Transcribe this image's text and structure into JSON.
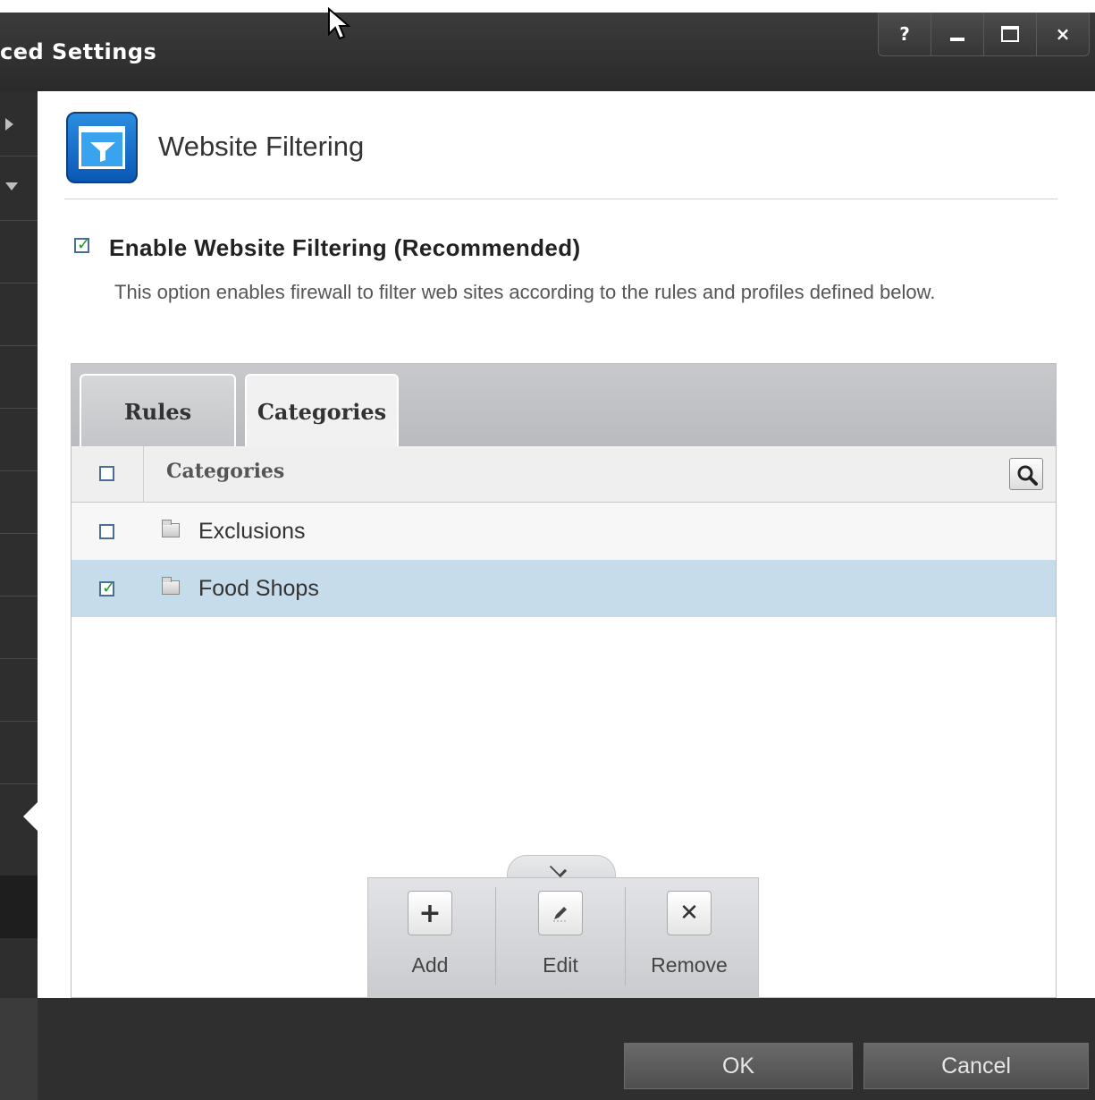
{
  "window": {
    "title": "ced Settings",
    "controls": {
      "help": "?",
      "minimize": "minimize",
      "maximize": "maximize",
      "close": "×"
    }
  },
  "header": {
    "icon": "website-filter-icon",
    "title": "Website Filtering"
  },
  "enable": {
    "checked": true,
    "label": "Enable Website Filtering (Recommended)",
    "description": "This option enables firewall to filter web sites according to the rules and profiles defined below."
  },
  "tabs": [
    {
      "label": "Rules",
      "active": false
    },
    {
      "label": "Categories",
      "active": true
    }
  ],
  "table": {
    "column_header": "Categories",
    "select_all_checked": false,
    "rows": [
      {
        "label": "Exclusions",
        "checked": false,
        "selected": false
      },
      {
        "label": "Food Shops",
        "checked": true,
        "selected": true
      }
    ]
  },
  "toolbar": {
    "add_label": "Add",
    "edit_label": "Edit",
    "remove_label": "Remove"
  },
  "footer": {
    "ok_label": "OK",
    "cancel_label": "Cancel"
  },
  "colors": {
    "selected_row": "#c7dceb",
    "accent_blue": "#1a73d0",
    "check_green": "#1e9a1e"
  }
}
